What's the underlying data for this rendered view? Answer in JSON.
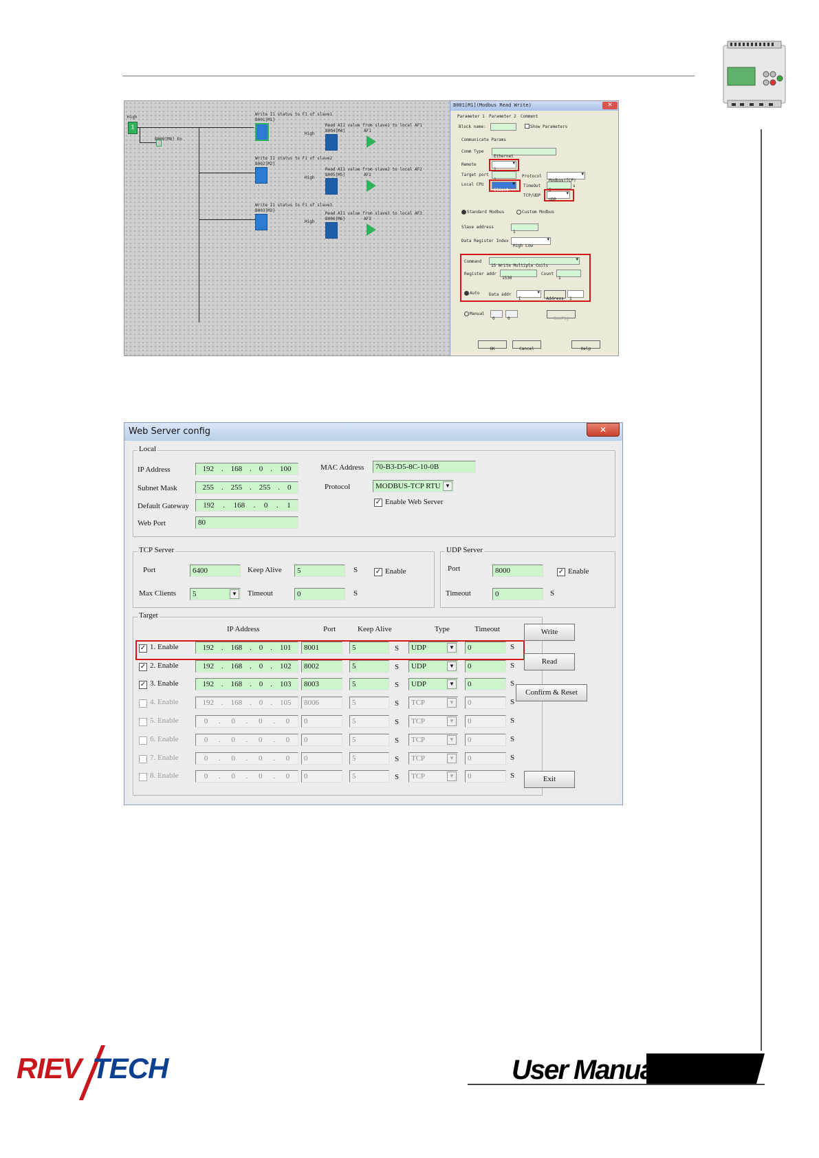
{
  "screenshot1": {
    "ladder": {
      "high_label": "High",
      "input_value": "1",
      "enable_block": "B008[M8] En",
      "blocks": [
        {
          "write_title": "Write I1 status to F1 of slave1",
          "write_block": "B001[M1]",
          "read_title": "Read AI1 value from slave1 to local AF1",
          "read_block": "B004[M4]",
          "high": "High",
          "af": "AF1"
        },
        {
          "write_title": "Write I1 status to F1 of slave2",
          "write_block": "B002[M2]",
          "read_title": "Read AI1 value from slave2 to local AF2",
          "read_block": "B005[M5]",
          "high": "High",
          "af": "AF2"
        },
        {
          "write_title": "Write I1 status to F1 of slave3",
          "write_block": "B003[M3]",
          "read_title": "Read AI1 value from slave3 to local AF3",
          "read_block": "B006[M6]",
          "high": "High",
          "af": "AF3"
        }
      ]
    },
    "dialog": {
      "title": "B001[M1](Modbus Read Write)",
      "tabs": [
        "Parameter 1",
        "Parameter 2",
        "Comment"
      ],
      "block_name_label": "Block name:",
      "show_params_label": "Show Parameters",
      "communicate_params": "Communicate Params",
      "comm_type_label": "Comm Type",
      "comm_type_value": "Ethernet",
      "remote_label": "Remote",
      "remote_value": "1",
      "target_port_label": "Target port",
      "target_port_value": "1",
      "protocol_label": "Protocol",
      "protocol_value": "Modbus(TCP)",
      "local_cpu_label": "Local CPU",
      "local_cpu_value": "Client",
      "timeout_label": "TimeOut",
      "timeout_value": "5",
      "timeout_unit": "s",
      "tcpudp_label": "TCP/UDP",
      "tcpudp_value": "UDP",
      "standard_modbus": "Standard Modbus",
      "custom_modbus": "Custom Modbus",
      "slave_address_label": "Slave address",
      "slave_address_value": "1",
      "data_register_label": "Data Register Index",
      "data_register_value": "High Low",
      "command_label": "Command",
      "command_value": "15 Write Multiple Coils",
      "register_addr_label": "Register addr",
      "register_addr_value": "1536",
      "count_label": "Count",
      "count_value": "1",
      "auto_label": "Auto",
      "data_addr_label": "Data addr",
      "data_addr_value": "I",
      "address_label": "Address",
      "address_value": "1",
      "manual_label": "Manual",
      "manual_value1": "0",
      "manual_value2": "0",
      "config_label": "Config",
      "ok_label": "OK",
      "cancel_label": "Cancel",
      "help_label": "Help"
    }
  },
  "screenshot2": {
    "title": "Web Server config",
    "close_glyph": "✕",
    "local": {
      "label": "Local",
      "ip_label": "IP Address",
      "ip": [
        "192",
        "168",
        "0",
        "100"
      ],
      "mask_label": "Subnet Mask",
      "mask": [
        "255",
        "255",
        "255",
        "0"
      ],
      "gateway_label": "Default Gateway",
      "gateway": [
        "192",
        "168",
        "0",
        "1"
      ],
      "webport_label": "Web Port",
      "webport": "80",
      "mac_label": "MAC Address",
      "mac": "70-B3-D5-8C-10-0B",
      "protocol_label": "Protocol",
      "protocol": "MODBUS-TCP RTU",
      "enable_web_label": "Enable Web Server"
    },
    "tcp": {
      "label": "TCP Server",
      "port_label": "Port",
      "port": "6400",
      "keepalive_label": "Keep Alive",
      "keepalive": "5",
      "s_unit": "S",
      "enable_label": "Enable",
      "maxclients_label": "Max Clients",
      "maxclients": "5",
      "timeout_label": "Timeout",
      "timeout": "0"
    },
    "udp": {
      "label": "UDP Server",
      "port_label": "Port",
      "port": "8000",
      "enable_label": "Enable",
      "timeout_label": "Timeout",
      "timeout": "0",
      "s_unit": "S"
    },
    "target": {
      "label": "Target",
      "headers": {
        "ip": "IP Address",
        "port": "Port",
        "keepalive": "Keep Alive",
        "type": "Type",
        "timeout": "Timeout"
      },
      "s_unit": "S",
      "rows": [
        {
          "label": "1. Enable",
          "checked": true,
          "ip": [
            "192",
            "168",
            "0",
            "101"
          ],
          "port": "8001",
          "keepalive": "5",
          "type": "UDP",
          "timeout": "0"
        },
        {
          "label": "2. Enable",
          "checked": true,
          "ip": [
            "192",
            "168",
            "0",
            "102"
          ],
          "port": "8002",
          "keepalive": "5",
          "type": "UDP",
          "timeout": "0"
        },
        {
          "label": "3. Enable",
          "checked": true,
          "ip": [
            "192",
            "168",
            "0",
            "103"
          ],
          "port": "8003",
          "keepalive": "5",
          "type": "UDP",
          "timeout": "0"
        },
        {
          "label": "4. Enable",
          "checked": false,
          "ip": [
            "192",
            "168",
            "0",
            "105"
          ],
          "port": "8006",
          "keepalive": "5",
          "type": "TCP",
          "timeout": "0"
        },
        {
          "label": "5. Enable",
          "checked": false,
          "ip": [
            "0",
            "0",
            "0",
            "0"
          ],
          "port": "0",
          "keepalive": "5",
          "type": "TCP",
          "timeout": "0"
        },
        {
          "label": "6. Enable",
          "checked": false,
          "ip": [
            "0",
            "0",
            "0",
            "0"
          ],
          "port": "0",
          "keepalive": "5",
          "type": "TCP",
          "timeout": "0"
        },
        {
          "label": "7. Enable",
          "checked": false,
          "ip": [
            "0",
            "0",
            "0",
            "0"
          ],
          "port": "0",
          "keepalive": "5",
          "type": "TCP",
          "timeout": "0"
        },
        {
          "label": "8. Enable",
          "checked": false,
          "ip": [
            "0",
            "0",
            "0",
            "0"
          ],
          "port": "0",
          "keepalive": "5",
          "type": "TCP",
          "timeout": "0"
        }
      ]
    },
    "buttons": {
      "write": "Write",
      "read": "Read",
      "confirm": "Confirm & Reset",
      "exit": "Exit"
    }
  },
  "footer": {
    "brand_left": "RIEV",
    "brand_right": "TECH",
    "manual_label": "User Manual"
  },
  "colors": {
    "field_green": "#ccf5cc",
    "highlight_red": "#d01818",
    "brand_red": "#c8161d",
    "brand_blue": "#0d3f8f"
  }
}
